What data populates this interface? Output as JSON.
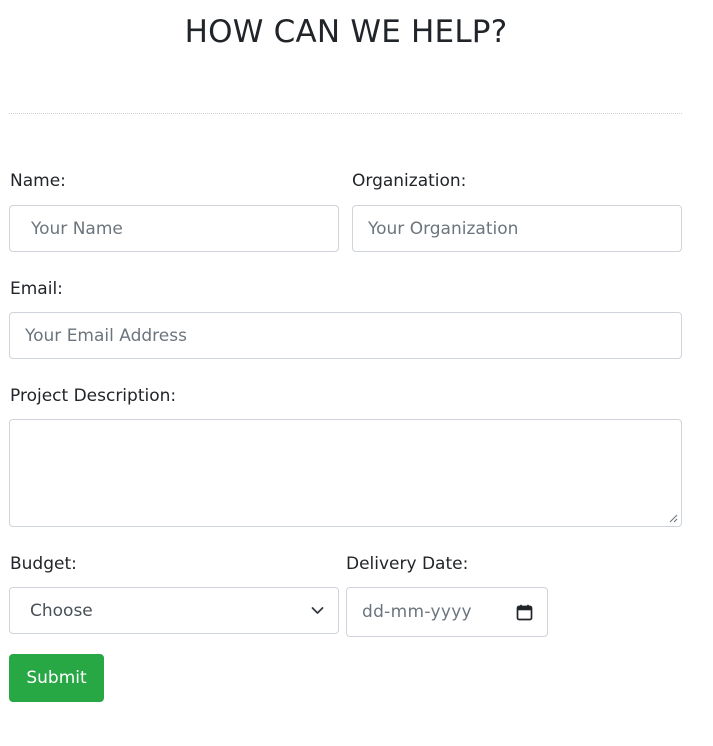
{
  "form": {
    "title": "HOW CAN WE HELP?",
    "name": {
      "label": "Name:",
      "placeholder": "Your Name"
    },
    "organization": {
      "label": "Organization:",
      "placeholder": "Your Organization"
    },
    "email": {
      "label": "Email:",
      "placeholder": "Your Email Address"
    },
    "project_description": {
      "label": "Project Description:",
      "value": ""
    },
    "budget": {
      "label": "Budget:",
      "selected": "Choose",
      "icon": "chevron-down-icon"
    },
    "delivery_date": {
      "label": "Delivery Date:",
      "placeholder": "dd-mm-yyyy",
      "icon": "calendar-icon"
    },
    "submit_label": "Submit",
    "colors": {
      "submit_bg": "#28a745",
      "input_border": "#ced4da",
      "text": "#212529"
    }
  }
}
